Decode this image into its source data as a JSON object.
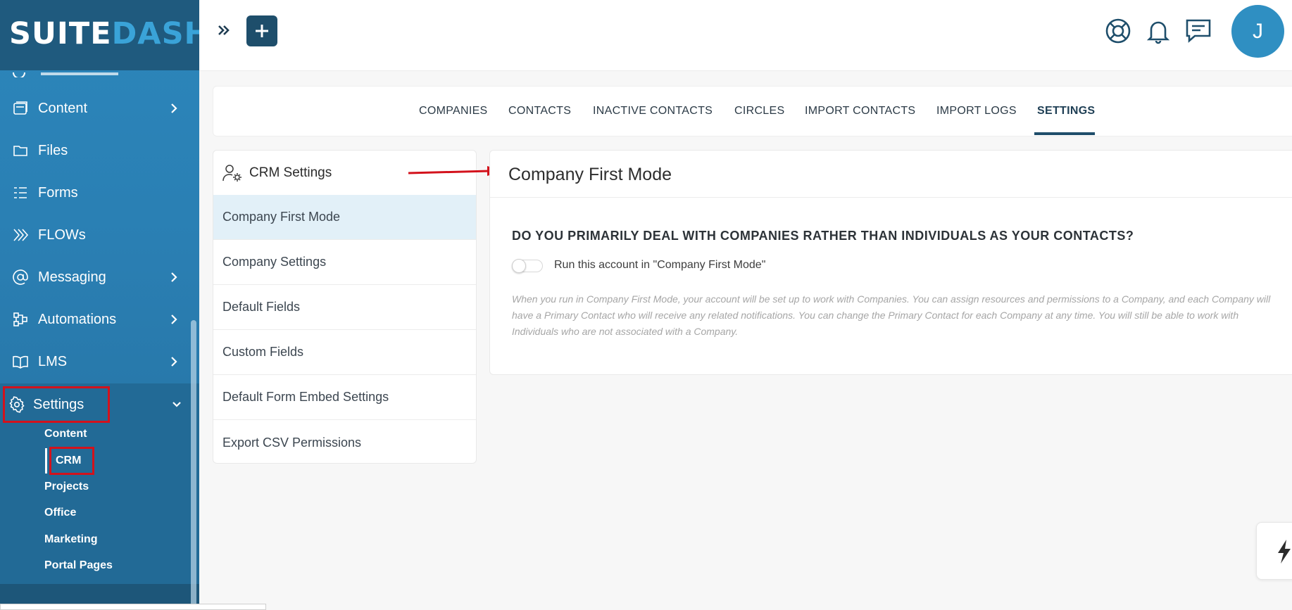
{
  "brand": {
    "logo_part1": "SUITE",
    "logo_part2": "DASH"
  },
  "sidebar": {
    "items": [
      {
        "label": "Content",
        "icon": "content-icon",
        "has_chevron": true
      },
      {
        "label": "Files",
        "icon": "folder-icon",
        "has_chevron": false
      },
      {
        "label": "Forms",
        "icon": "forms-icon",
        "has_chevron": false
      },
      {
        "label": "FLOWs",
        "icon": "flows-icon",
        "has_chevron": false
      },
      {
        "label": "Messaging",
        "icon": "at-icon",
        "has_chevron": true
      },
      {
        "label": "Automations",
        "icon": "automations-icon",
        "has_chevron": true
      },
      {
        "label": "LMS",
        "icon": "book-icon",
        "has_chevron": true
      }
    ],
    "settings": {
      "label": "Settings",
      "icon": "gear-icon",
      "submenu": [
        "Content",
        "CRM",
        "Projects",
        "Office",
        "Marketing",
        "Portal Pages"
      ],
      "active_submenu": "CRM"
    }
  },
  "topbar": {
    "icons": [
      "expand-icon",
      "plus-icon",
      "support-icon",
      "bell-icon",
      "chat-icon"
    ],
    "avatar_initial": "J"
  },
  "tabs": [
    {
      "label": "COMPANIES",
      "active": false
    },
    {
      "label": "CONTACTS",
      "active": false
    },
    {
      "label": "INACTIVE CONTACTS",
      "active": false
    },
    {
      "label": "CIRCLES",
      "active": false
    },
    {
      "label": "IMPORT CONTACTS",
      "active": false
    },
    {
      "label": "IMPORT LOGS",
      "active": false
    },
    {
      "label": "SETTINGS",
      "active": true
    }
  ],
  "crm_menu": {
    "title": "CRM Settings",
    "items": [
      {
        "label": "Company First Mode",
        "active": true
      },
      {
        "label": "Company Settings",
        "active": false
      },
      {
        "label": "Default Fields",
        "active": false
      },
      {
        "label": "Custom Fields",
        "active": false
      },
      {
        "label": "Default Form Embed Settings",
        "active": false
      },
      {
        "label": "Export CSV Permissions",
        "active": false
      }
    ]
  },
  "panel": {
    "title": "Company First Mode",
    "question": "DO YOU PRIMARILY DEAL WITH COMPANIES RATHER THAN INDIVIDUALS AS YOUR CONTACTS?",
    "toggle_label": "Run this account in \"Company First Mode\"",
    "toggle_on": false,
    "description": "When you run in Company First Mode, your account will be set up to work with Companies. You can assign resources and permissions to a Company, and each Company will have a Primary Contact who will receive any related notifications. You can change the Primary Contact for each Company at any time. You will still be able to work with Individuals who are not associated with a Company."
  },
  "colors": {
    "sidebar": "#2a7fb3",
    "sidebar_dark": "#1f5a7e",
    "accent": "#1f4e6b",
    "annotation_red": "#d3121c",
    "active_menu_bg": "#e2f0f8"
  }
}
